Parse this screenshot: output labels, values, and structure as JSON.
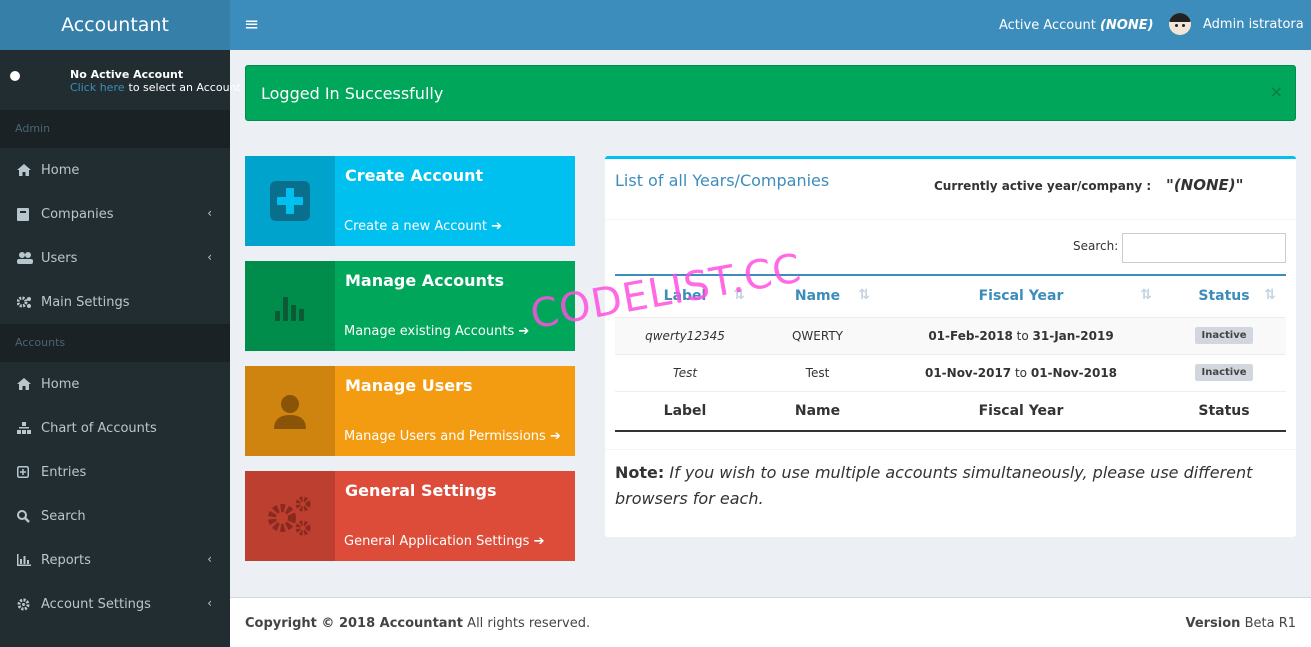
{
  "app": {
    "title": "Accountant"
  },
  "user_panel": {
    "name": "No Active Account",
    "link_text": "Click here",
    "rest_text": "to select an Account"
  },
  "sidebar": {
    "sections": [
      {
        "header": "Admin",
        "items": [
          {
            "label": "Home",
            "icon": "home-icon",
            "chevron": false
          },
          {
            "label": "Companies",
            "icon": "book-icon",
            "chevron": true
          },
          {
            "label": "Users",
            "icon": "users-icon",
            "chevron": true
          },
          {
            "label": "Main Settings",
            "icon": "gears-icon",
            "chevron": false
          }
        ]
      },
      {
        "header": "Accounts",
        "items": [
          {
            "label": "Home",
            "icon": "home-icon",
            "chevron": false
          },
          {
            "label": "Chart of Accounts",
            "icon": "sitemap-icon",
            "chevron": false
          },
          {
            "label": "Entries",
            "icon": "plus-square-icon",
            "chevron": false
          },
          {
            "label": "Search",
            "icon": "search-icon",
            "chevron": false
          },
          {
            "label": "Reports",
            "icon": "bar-chart-icon",
            "chevron": true
          },
          {
            "label": "Account Settings",
            "icon": "gear-icon",
            "chevron": true
          }
        ]
      }
    ]
  },
  "topbar": {
    "active_account_label": "Active Account",
    "active_account_value": "(NONE)",
    "user_name": "Admin istratora"
  },
  "alert": {
    "message": "Logged In Successfully",
    "close": "×"
  },
  "info_boxes": [
    {
      "title": "Create Account",
      "link": "Create a new Account",
      "icon": "plus-square-icon",
      "color": "#00c0ef"
    },
    {
      "title": "Manage Accounts",
      "link": "Manage existing Accounts",
      "icon": "bar-chart-icon",
      "color": "#00a65a"
    },
    {
      "title": "Manage Users",
      "link": "Manage Users and Permissions",
      "icon": "user-icon",
      "color": "#f39c12"
    },
    {
      "title": "General Settings",
      "link": "General Application Settings",
      "icon": "gears-icon",
      "color": "#dd4b39"
    }
  ],
  "companies_box": {
    "title": "List of all Years/Companies",
    "current_label": "Currently active year/company :",
    "current_value": "\"(NONE)\"",
    "search_label": "Search:",
    "columns": [
      "Label",
      "Name",
      "Fiscal Year",
      "Status"
    ],
    "rows": [
      {
        "label": "qwerty12345",
        "name": "QWERTY",
        "fy_start": "01-Feb-2018",
        "fy_to": "to",
        "fy_end": "31-Jan-2019",
        "status": "Inactive"
      },
      {
        "label": "Test",
        "name": "Test",
        "fy_start": "01-Nov-2017",
        "fy_to": "to",
        "fy_end": "01-Nov-2018",
        "status": "Inactive"
      }
    ],
    "note_label": "Note:",
    "note_text": "If you wish to use multiple accounts simultaneously, please use different browsers for each."
  },
  "footer": {
    "copyright": "Copyright © 2018 Accountant",
    "rights": "All rights reserved.",
    "version_label": "Version",
    "version_value": "Beta R1"
  },
  "watermark": "CODELIST.CC"
}
